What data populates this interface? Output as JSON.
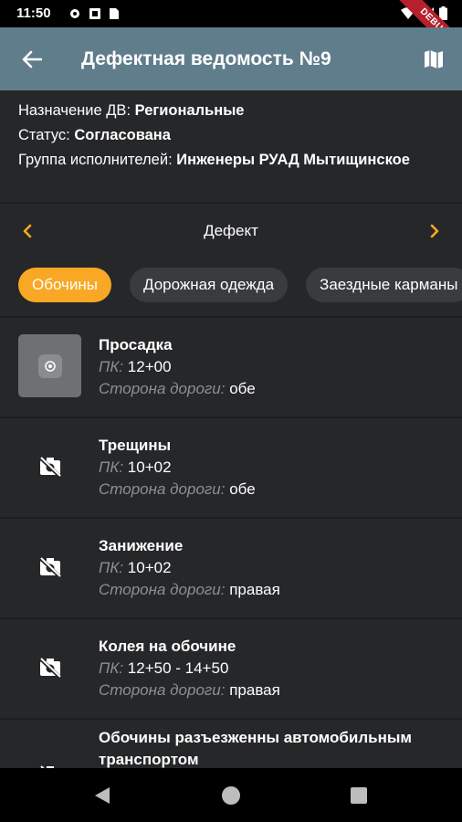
{
  "status_bar": {
    "time": "11:50",
    "debug_badge": "DEBUG"
  },
  "app_bar": {
    "title": "Дефектная ведомость №9"
  },
  "info": {
    "purpose_label": "Назначение ДВ: ",
    "purpose_value": "Региональные",
    "status_label": "Статус: ",
    "status_value": "Согласована",
    "group_label": "Группа исполнителей: ",
    "group_value": "Инженеры РУАД Мытищинское"
  },
  "section": {
    "title": "Дефект"
  },
  "chips": [
    "Обочины",
    "Дорожная одежда",
    "Заездные карманы"
  ],
  "colors": {
    "accent": "#f9a825",
    "app_bar": "#607d8b",
    "background": "#262729"
  },
  "defect_labels": {
    "pk": "ПК:",
    "side": "Сторона дороги:"
  },
  "defects": [
    {
      "name": "Просадка",
      "pk": "12+00",
      "side": "обе",
      "has_photo": true
    },
    {
      "name": "Трещины",
      "pk": "10+02",
      "side": "обе",
      "has_photo": false
    },
    {
      "name": "Занижение",
      "pk": "10+02",
      "side": "правая",
      "has_photo": false
    },
    {
      "name": "Колея на обочине",
      "pk": "12+50 - 14+50",
      "side": "правая",
      "has_photo": false
    },
    {
      "name": "Обочины разъезженны автомобильным транспортом",
      "pk": "",
      "side": "",
      "has_photo": false
    }
  ]
}
